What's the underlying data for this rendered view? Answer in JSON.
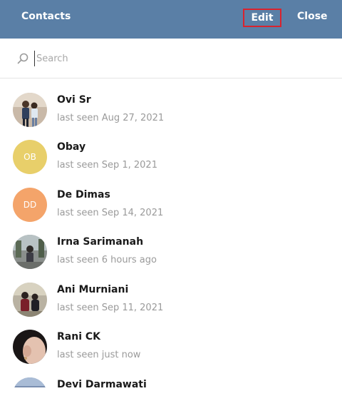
{
  "header": {
    "title": "Contacts",
    "edit_label": "Edit",
    "close_label": "Close",
    "color": "#5a7fa6",
    "edit_highlight_color": "#d9232e"
  },
  "search": {
    "placeholder": "Search",
    "value": "",
    "icon": "search-icon"
  },
  "contacts": [
    {
      "name": "Ovi Sr",
      "status": "last seen Aug 27, 2021",
      "avatar": {
        "type": "photo"
      }
    },
    {
      "name": "Obay",
      "status": "last seen Sep 1, 2021",
      "avatar": {
        "type": "initials",
        "initials": "OB",
        "color": "#e8cf6a"
      }
    },
    {
      "name": "De Dimas",
      "status": "last seen Sep 14, 2021",
      "avatar": {
        "type": "initials",
        "initials": "DD",
        "color": "#f4a46a"
      }
    },
    {
      "name": "Irna Sarimanah",
      "status": "last seen 6 hours ago",
      "avatar": {
        "type": "photo"
      }
    },
    {
      "name": "Ani Murniani",
      "status": "last seen Sep 11, 2021",
      "avatar": {
        "type": "photo"
      }
    },
    {
      "name": "Rani CK",
      "status": "last seen just now",
      "avatar": {
        "type": "photo"
      }
    },
    {
      "name": "Devi Darmawati",
      "status": "",
      "avatar": {
        "type": "photo"
      }
    }
  ]
}
